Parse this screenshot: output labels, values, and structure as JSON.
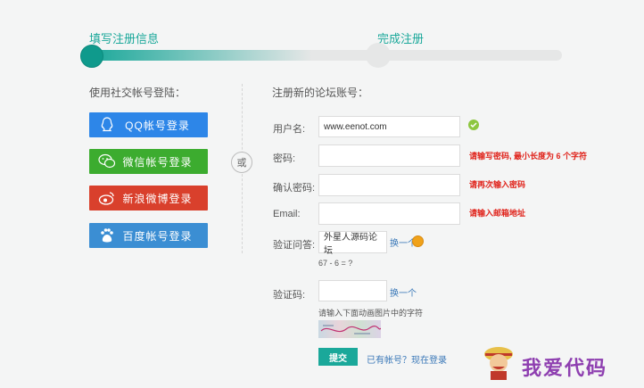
{
  "steps": {
    "step1": "填写注册信息",
    "step2": "完成注册"
  },
  "social": {
    "title": "使用社交帐号登陆：",
    "buttons": [
      {
        "label": "QQ帐号登录",
        "color": "#2d86e8",
        "icon": "qq-icon"
      },
      {
        "label": "微信帐号登录",
        "color": "#3cac2f",
        "icon": "wechat-icon"
      },
      {
        "label": "新浪微博登录",
        "color": "#d9402c",
        "icon": "weibo-icon"
      },
      {
        "label": "百度帐号登录",
        "color": "#3b8ed3",
        "icon": "baidu-icon"
      }
    ],
    "or_text": "或"
  },
  "form": {
    "title": "注册新的论坛账号：",
    "username": {
      "label": "用户名:",
      "value": "www.eenot.com"
    },
    "password": {
      "label": "密码:",
      "error": "请输写密码, 最小长度为 6 个字符"
    },
    "confirm": {
      "label": "确认密码:",
      "error": "请再次输入密码"
    },
    "email": {
      "label": "Email:",
      "error": "请输入邮箱地址"
    },
    "question": {
      "label": "验证问答:",
      "value": "外星人源码论坛",
      "swap": "换一个",
      "expression": "67 - 6 = ?"
    },
    "captcha": {
      "label": "验证码:",
      "swap": "换一个",
      "hint": "请输入下面动画图片中的字符"
    },
    "submit": "提交",
    "login_link": "已有帐号？现在登录"
  },
  "watermark": "我爱代码",
  "colors": {
    "accent": "#1aa89a",
    "error": "#e0231b"
  }
}
